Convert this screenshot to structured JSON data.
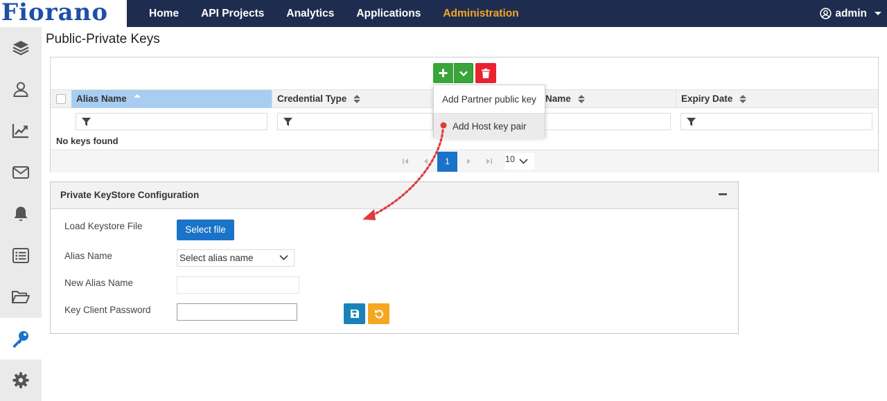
{
  "brand": {
    "logo_text": "Fiorano"
  },
  "nav": {
    "items": [
      {
        "label": "Home"
      },
      {
        "label": "API Projects"
      },
      {
        "label": "Analytics"
      },
      {
        "label": "Applications"
      },
      {
        "label": "Administration"
      }
    ],
    "active": "Administration",
    "user": "admin"
  },
  "sidebar": {
    "items": [
      {
        "icon": "layers-icon"
      },
      {
        "icon": "user-icon"
      },
      {
        "icon": "chart-icon"
      },
      {
        "icon": "mail-icon"
      },
      {
        "icon": "bell-icon"
      },
      {
        "icon": "list-icon"
      },
      {
        "icon": "folder-icon"
      },
      {
        "icon": "key-icon",
        "active": true
      },
      {
        "icon": "gear-icon"
      }
    ]
  },
  "page": {
    "title": "Public-Private Keys"
  },
  "grid": {
    "columns": [
      {
        "label": "Alias Name",
        "sorted": "asc"
      },
      {
        "label": "Credential Type"
      },
      {
        "label": "Name"
      },
      {
        "label": "Expiry Date"
      }
    ],
    "empty_text": "No keys found",
    "pager": {
      "current_page": "1",
      "page_size": "10"
    }
  },
  "add_menu": {
    "items": [
      {
        "label": "Add Partner public key"
      },
      {
        "label": "Add Host key pair"
      }
    ]
  },
  "keystore": {
    "title": "Private KeyStore Configuration",
    "load_label": "Load Keystore File",
    "select_file_label": "Select file",
    "alias_label": "Alias Name",
    "alias_selected": "Select alias name",
    "new_alias_label": "New Alias Name",
    "new_alias_value": "",
    "password_label": "Key Client Password",
    "password_value": ""
  },
  "colors": {
    "nav_bg": "#1e2d4f",
    "nav_active": "#f5a623",
    "primary": "#1a73c8",
    "add": "#3aa53a",
    "delete": "#e8232f",
    "annotation": "#e03c3c"
  }
}
